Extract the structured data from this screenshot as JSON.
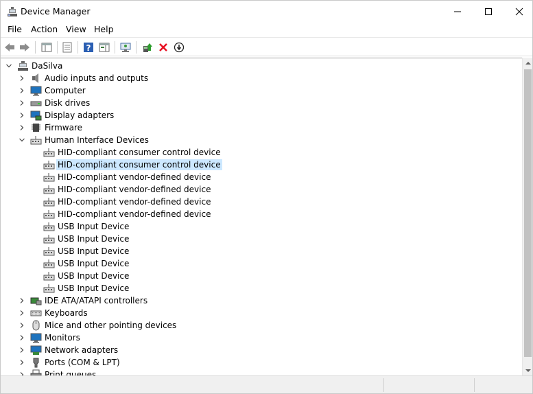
{
  "window": {
    "title": "Device Manager",
    "icon": "device-manager-icon"
  },
  "menu": [
    {
      "label": "File"
    },
    {
      "label": "Action"
    },
    {
      "label": "View"
    },
    {
      "label": "Help"
    }
  ],
  "toolbar": {
    "buttons": [
      "back-icon",
      "forward-icon",
      "show-hide-console-tree-icon",
      "properties-icon",
      "help-icon",
      "action-pane-icon",
      "scan-hardware-icon",
      "update-driver-icon",
      "uninstall-device-icon",
      "disable-device-icon"
    ]
  },
  "tree": {
    "root": "DaSilva",
    "categories": {
      "audio": "Audio inputs and outputs",
      "computer": "Computer",
      "disk": "Disk drives",
      "display": "Display adapters",
      "firmware": "Firmware",
      "hid": "Human Interface Devices",
      "ide": "IDE ATA/ATAPI controllers",
      "keyboards": "Keyboards",
      "mice": "Mice and other pointing devices",
      "monitors": "Monitors",
      "network": "Network adapters",
      "ports": "Ports (COM & LPT)",
      "print": "Print queues"
    },
    "hid_devices": [
      "HID-compliant consumer control device",
      "HID-compliant consumer control device",
      "HID-compliant vendor-defined device",
      "HID-compliant vendor-defined device",
      "HID-compliant vendor-defined device",
      "HID-compliant vendor-defined device",
      "USB Input Device",
      "USB Input Device",
      "USB Input Device",
      "USB Input Device",
      "USB Input Device",
      "USB Input Device"
    ],
    "selected_index": 1
  },
  "colors": {
    "selection": "#cce8ff",
    "accent_blue": "#1e73be",
    "uninstall_red": "#e81123"
  }
}
